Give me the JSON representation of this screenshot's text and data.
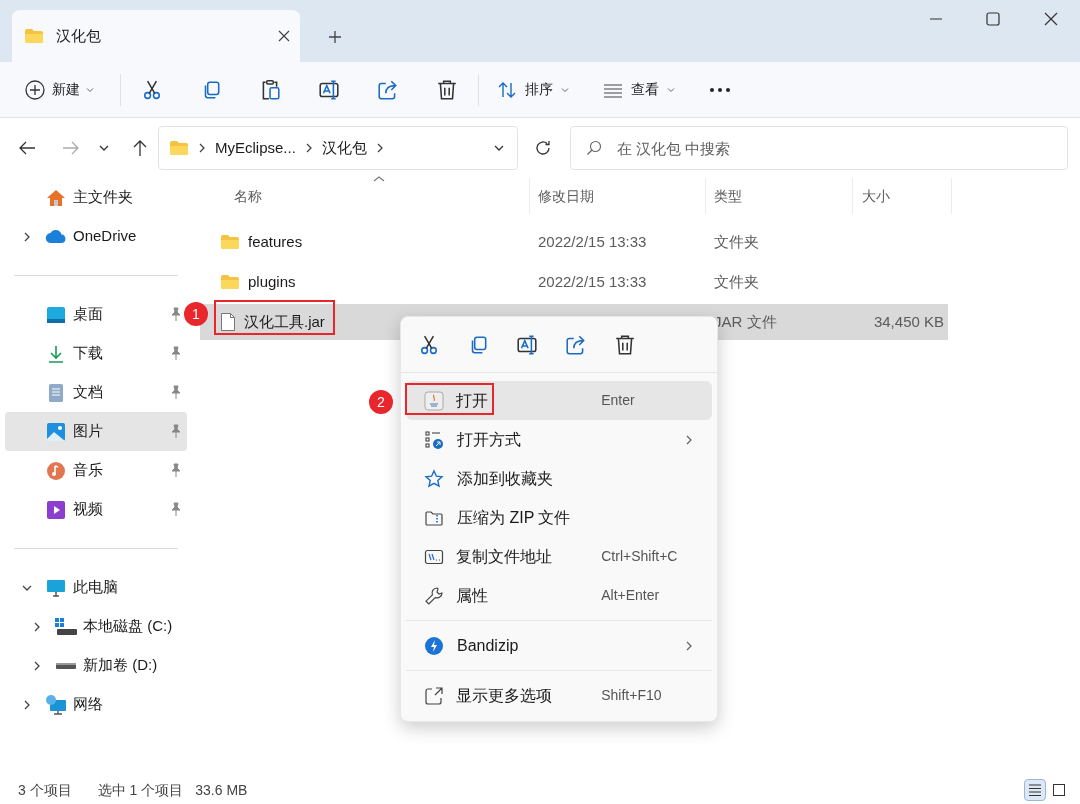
{
  "window": {
    "tab_title": "汉化包"
  },
  "toolbar": {
    "new": "新建",
    "sort": "排序",
    "view": "查看"
  },
  "address": {
    "path": [
      "MyEclipse...",
      "汉化包"
    ]
  },
  "search": {
    "placeholder": "在 汉化包 中搜索"
  },
  "sidebar": {
    "groups": [
      [
        {
          "label": "主文件夹",
          "kind": "home",
          "selected": false
        },
        {
          "label": "OneDrive",
          "kind": "cloud",
          "selected": false,
          "expanded": false
        }
      ],
      [
        {
          "label": "桌面",
          "kind": "desktop",
          "selected": false,
          "pinned": true
        },
        {
          "label": "下载",
          "kind": "download",
          "selected": false,
          "pinned": true
        },
        {
          "label": "文档",
          "kind": "document",
          "selected": false,
          "pinned": true
        },
        {
          "label": "图片",
          "kind": "pictures",
          "selected": true,
          "pinned": true
        },
        {
          "label": "音乐",
          "kind": "music",
          "selected": false,
          "pinned": true
        },
        {
          "label": "视频",
          "kind": "video",
          "selected": false,
          "pinned": true
        }
      ],
      [
        {
          "label": "此电脑",
          "kind": "pc",
          "selected": false,
          "expanded": true,
          "children": [
            {
              "label": "本地磁盘 (C:)",
              "kind": "system-drive",
              "selected": false,
              "expanded": false
            },
            {
              "label": "新加卷 (D:)",
              "kind": "drive",
              "selected": false,
              "expanded": false
            }
          ]
        },
        {
          "label": "网络",
          "kind": "network",
          "selected": false,
          "expanded": false
        }
      ]
    ]
  },
  "columns": [
    {
      "label": "名称",
      "sorted": true
    },
    {
      "label": "修改日期",
      "sorted": false
    },
    {
      "label": "类型",
      "sorted": false
    },
    {
      "label": "大小",
      "sorted": false
    }
  ],
  "files": [
    {
      "name": "features",
      "kind": "folder",
      "date": "2022/2/15 13:33",
      "type": "文件夹",
      "selected": false
    },
    {
      "name": "plugins",
      "kind": "folder",
      "date": "2022/2/15 13:33",
      "type": "文件夹",
      "selected": false
    },
    {
      "name": "汉化工具.jar",
      "kind": "file",
      "type": "JAR 文件",
      "size": "34,450 KB",
      "selected": true
    }
  ],
  "context_menu": {
    "groups": [
      [
        {
          "label": "打开",
          "kind": "java",
          "shortcut": "Enter",
          "highlighted": true
        },
        {
          "label": "打开方式",
          "kind": "open-with",
          "submenu": true,
          "highlighted": false
        },
        {
          "label": "添加到收藏夹",
          "kind": "star",
          "highlighted": false
        },
        {
          "label": "压缩为 ZIP 文件",
          "kind": "zip",
          "highlighted": false
        },
        {
          "label": "复制文件地址",
          "kind": "path",
          "shortcut": "Ctrl+Shift+C",
          "highlighted": false
        },
        {
          "label": "属性",
          "kind": "wrench",
          "shortcut": "Alt+Enter",
          "highlighted": false
        }
      ],
      [
        {
          "label": "Bandizip",
          "kind": "bandizip",
          "submenu": true,
          "highlighted": false
        }
      ],
      [
        {
          "label": "显示更多选项",
          "kind": "more",
          "shortcut": "Shift+F10",
          "highlighted": false
        }
      ]
    ]
  },
  "annotations": [
    {
      "label": "1"
    },
    {
      "label": "2"
    }
  ],
  "status_bar": {
    "count": "3 个项目",
    "selection": "选中 1 个项目",
    "size": "33.6 MB"
  },
  "view_buttons": [
    {
      "kind": "details",
      "selected": true
    },
    {
      "kind": "tiles",
      "selected": false
    }
  ]
}
